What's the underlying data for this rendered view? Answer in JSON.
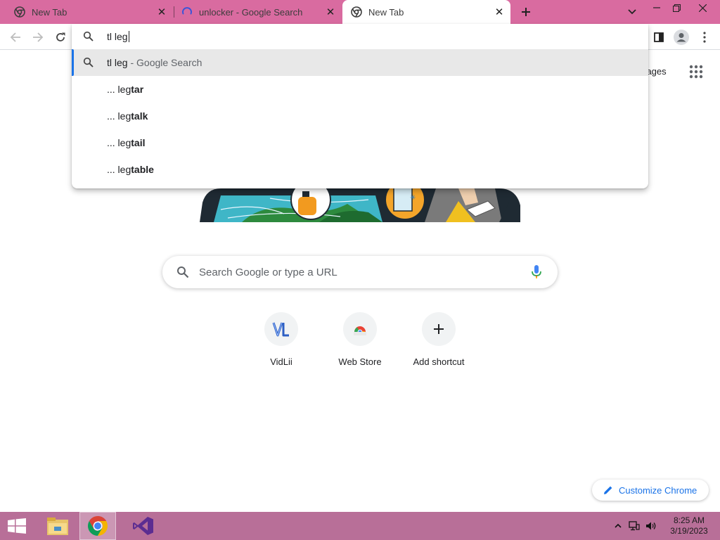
{
  "tabs": [
    {
      "title": "New Tab",
      "active": false
    },
    {
      "title": "unlocker - Google Search",
      "active": false,
      "loading": true
    },
    {
      "title": "New Tab",
      "active": true
    }
  ],
  "omnibox": {
    "input": "tl leg",
    "suggestions": [
      {
        "prefix": "tl leg",
        "suffix": " - Google Search",
        "selected": true,
        "icon": "search-icon"
      },
      {
        "prefix": "... leg",
        "bold": "tar"
      },
      {
        "prefix": "... leg",
        "bold": "talk"
      },
      {
        "prefix": "... leg",
        "bold": "tail"
      },
      {
        "prefix": "... leg",
        "bold": "table"
      }
    ]
  },
  "header": {
    "images_link": "Images"
  },
  "search": {
    "placeholder": "Search Google or type a URL"
  },
  "shortcuts": [
    {
      "label": "VidLii",
      "icon": "vidlii-icon"
    },
    {
      "label": "Web Store",
      "icon": "webstore-icon"
    },
    {
      "label": "Add shortcut",
      "icon": "plus-icon"
    }
  ],
  "customize": {
    "label": "Customize Chrome"
  },
  "taskbar": {
    "time": "8:25 AM",
    "date": "3/19/2023"
  },
  "colors": {
    "tabstrip": "#d96ba0",
    "taskbar": "#b86f98",
    "accent": "#1a73e8"
  }
}
